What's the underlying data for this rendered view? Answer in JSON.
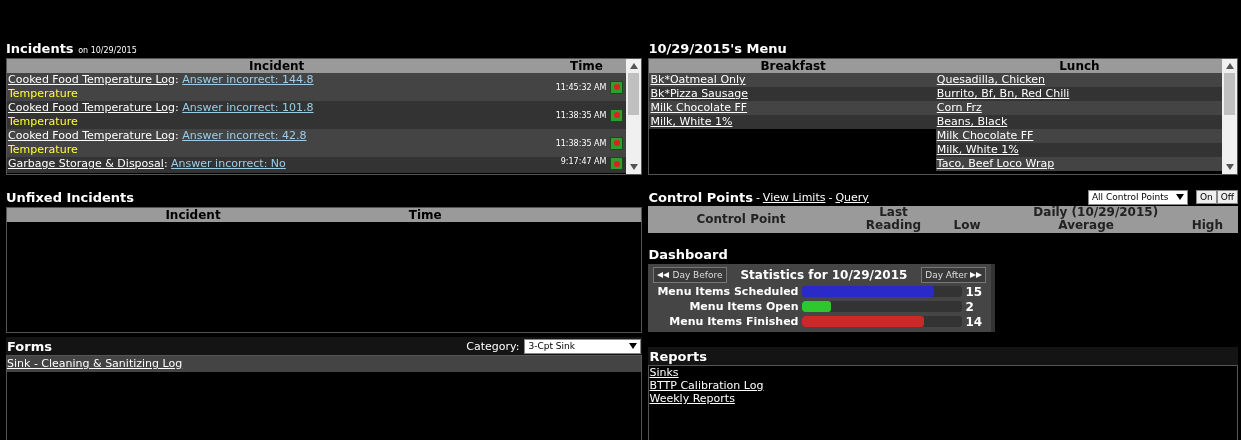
{
  "incidents": {
    "title": "Incidents",
    "date": "on 10/29/2015",
    "separator": ":",
    "columns": [
      "Incident",
      "Time"
    ],
    "rows": [
      {
        "form": "Cooked Food Temperature Log",
        "answer": "Answer incorrect: 144.8",
        "category": "Temperature",
        "time": "11:45:32 AM"
      },
      {
        "form": "Cooked Food Temperature Log",
        "answer": "Answer incorrect: 101.8",
        "category": "Temperature",
        "time": "11:38:35 AM"
      },
      {
        "form": "Cooked Food Temperature Log",
        "answer": "Answer incorrect: 42.8",
        "category": "Temperature",
        "time": "11:38:35 AM"
      },
      {
        "form": "Garbage Storage & Disposal",
        "answer": "Answer incorrect: No",
        "time": "9:17:47 AM"
      }
    ]
  },
  "unfixed": {
    "title": "Unfixed Incidents",
    "columns": [
      "Incident",
      "Time"
    ]
  },
  "forms": {
    "title": "Forms",
    "category_label": "Category:",
    "category_value": "3-Cpt Sink",
    "items": [
      "Sink - Cleaning & Sanitizing Log"
    ]
  },
  "menu": {
    "title": "10/29/2015's Menu",
    "columns": [
      "Breakfast",
      "Lunch"
    ],
    "breakfast": [
      "Bk*Oatmeal Only",
      "Bk*Pizza Sausage",
      "Milk Chocolate FF",
      "Milk, White 1%"
    ],
    "lunch": [
      "Quesadilla, Chicken",
      "Burrito, Bf, Bn, Red Chili",
      "Corn Frz",
      "Beans, Black",
      "Milk Chocolate FF",
      "Milk, White 1%",
      "Taco, Beef Loco Wrap"
    ]
  },
  "control_points": {
    "title": "Control Points",
    "links": [
      "View Limits",
      "Query"
    ],
    "separator": "-",
    "filter": "All Control Points",
    "toggle": [
      "On",
      "Off"
    ],
    "columns": {
      "point": "Control Point",
      "last_top": "Last",
      "last_bottom": "Reading",
      "daily": "Daily (10/29/2015)",
      "low": "Low",
      "average": "Average",
      "high": "High"
    }
  },
  "dashboard": {
    "title": "Dashboard",
    "prev": "Day Before",
    "next": "Day After",
    "heading": "Statistics for 10/29/2015",
    "stats": [
      {
        "label": "Menu Items Scheduled",
        "value": "15",
        "level": 0.82,
        "color": "#2a2ac8"
      },
      {
        "label": "Menu Items Open",
        "value": "2",
        "level": 0.18,
        "color": "#2ec82e"
      },
      {
        "label": "Menu Items Finished",
        "value": "14",
        "level": 0.76,
        "color": "#c82a2a"
      }
    ]
  },
  "reports": {
    "title": "Reports",
    "items": [
      "Sinks",
      "BTTP Calibration Log",
      "Weekly Reports"
    ]
  }
}
